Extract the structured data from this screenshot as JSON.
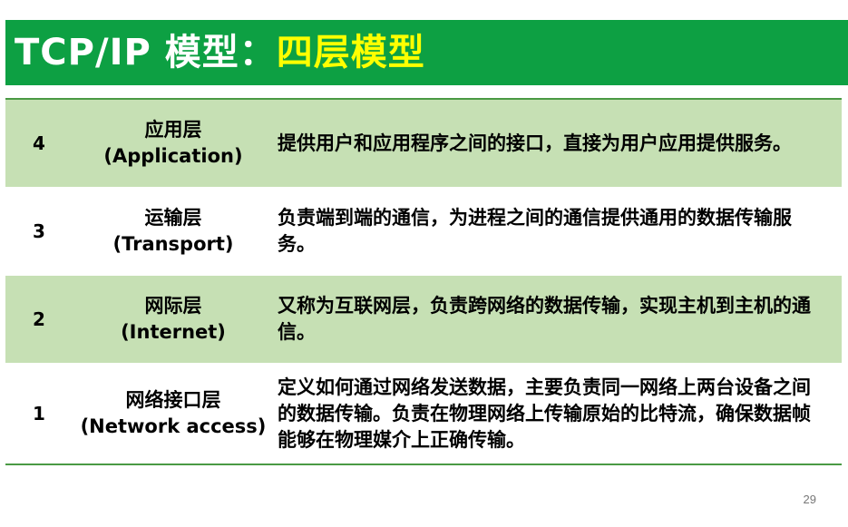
{
  "title": {
    "main": "TCP/IP 模型：",
    "accent": "四层模型"
  },
  "colors": {
    "title_bg": "#0da043",
    "title_text": "#ffffff",
    "title_accent": "#ffff00",
    "shaded_row": "#c6e0b4"
  },
  "layers": [
    {
      "number": "4",
      "name_zh": "应用层",
      "name_en": "(Application)",
      "description": "提供用户和应用程序之间的接口，直接为用户应用提供服务。"
    },
    {
      "number": "3",
      "name_zh": "运输层",
      "name_en": "(Transport)",
      "description": "负责端到端的通信，为进程之间的通信提供通用的数据传输服务。"
    },
    {
      "number": "2",
      "name_zh": "网际层",
      "name_en": "(Internet)",
      "description": "又称为互联网层，负责跨网络的数据传输，实现主机到主机的通信。"
    },
    {
      "number": "1",
      "name_zh": "网络接口层",
      "name_en": "(Network access)",
      "description": "定义如何通过网络发送数据，主要负责同一网络上两台设备之间的数据传输。负责在物理网络上传输原始的比特流，确保数据帧能够在物理媒介上正确传输。"
    }
  ],
  "page_number": "29"
}
